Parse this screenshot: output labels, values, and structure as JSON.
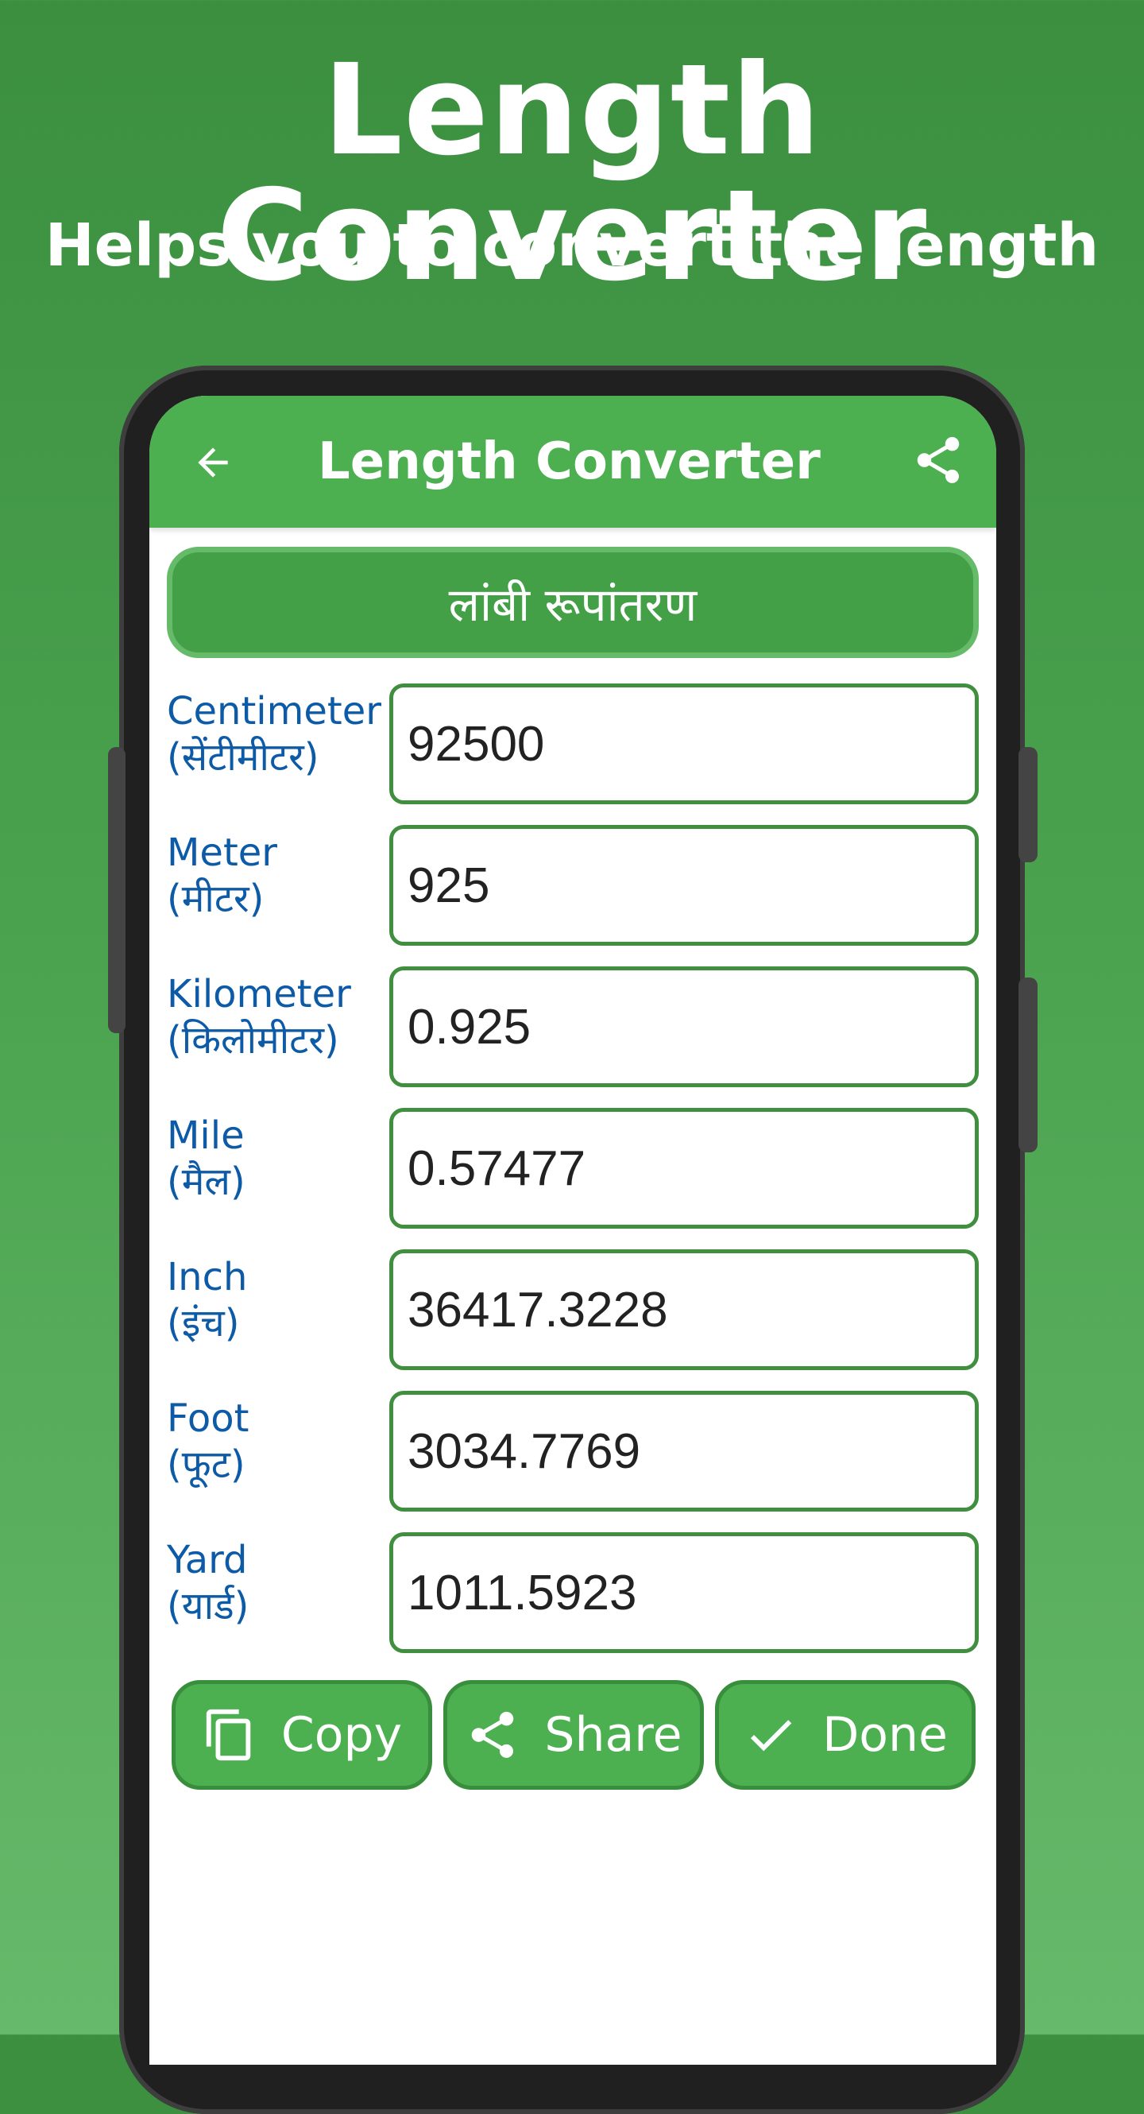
{
  "promo": {
    "title": "Length Converter",
    "subtitle": "Helps you to convert the length"
  },
  "appbar": {
    "title": "Length Converter",
    "back_icon": "arrow-back-icon",
    "share_icon": "share-icon"
  },
  "heading_button": {
    "label": "लांबी रूपांतरण"
  },
  "units": [
    {
      "name": "Centimeter",
      "local": "(सेंटीमीटर)",
      "value": "92500"
    },
    {
      "name": "Meter",
      "local": "(मीटर)",
      "value": "925"
    },
    {
      "name": "Kilometer",
      "local": "(किलोमीटर)",
      "value": "0.925"
    },
    {
      "name": "Mile",
      "local": "(मैल)",
      "value": "0.57477"
    },
    {
      "name": "Inch",
      "local": "(इंच)",
      "value": "36417.3228"
    },
    {
      "name": "Foot",
      "local": "(फूट)",
      "value": "3034.7769"
    },
    {
      "name": "Yard",
      "local": "(यार्ड)",
      "value": "1011.5923"
    }
  ],
  "actions": {
    "copy": {
      "label": "Copy",
      "icon": "copy-icon"
    },
    "share": {
      "label": "Share",
      "icon": "share-icon"
    },
    "done": {
      "label": "Done",
      "icon": "check-icon"
    }
  },
  "colors": {
    "primary": "#4caf50",
    "primary_dark": "#388e3c",
    "label_blue": "#0d5aa7",
    "input_border": "#3f8f3f"
  }
}
